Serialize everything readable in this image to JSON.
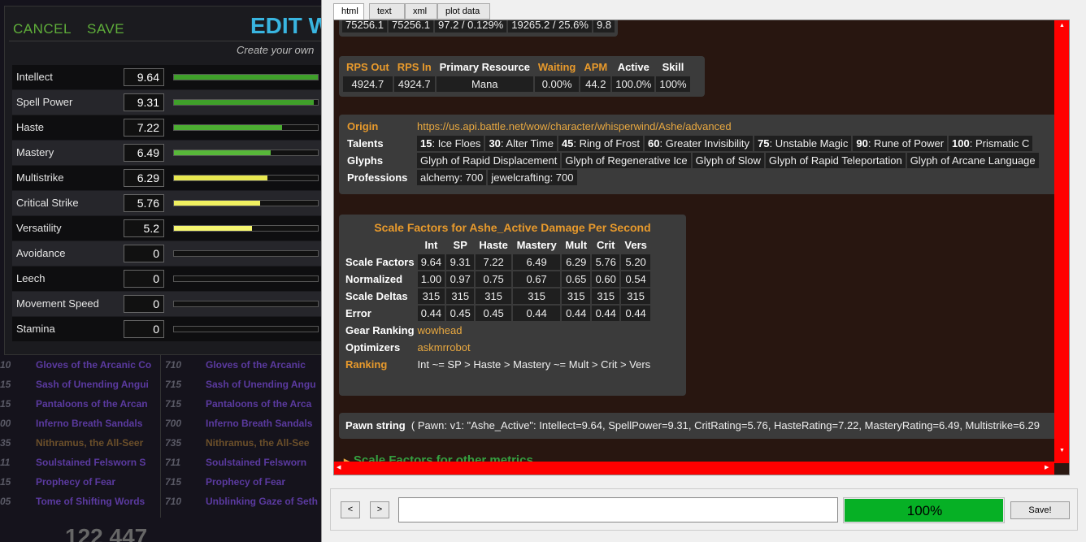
{
  "game": {
    "rows": [
      {
        "ilvl_left": "10",
        "name_left": "Gloves of the Arcanic Co",
        "ilvl_right": "710",
        "name_right": "Gloves of the Arcanic",
        "color": "purple"
      },
      {
        "ilvl_left": "15",
        "name_left": "Sash of Unending Angui",
        "ilvl_right": "715",
        "name_right": "Sash of Unending Angu",
        "color": "purple"
      },
      {
        "ilvl_left": "15",
        "name_left": "Pantaloons of the Arcan",
        "ilvl_right": "715",
        "name_right": "Pantaloons of the Arca",
        "color": "purple"
      },
      {
        "ilvl_left": "00",
        "name_left": "Inferno Breath Sandals",
        "ilvl_right": "700",
        "name_right": "Inferno Breath Sandals",
        "color": "purple"
      },
      {
        "ilvl_left": "35",
        "name_left": "Nithramus, the All-Seer",
        "ilvl_right": "735",
        "name_right": "Nithramus, the All-See",
        "color": "orange"
      },
      {
        "ilvl_left": "11",
        "name_left": "Soulstained Felsworn S",
        "ilvl_right": "711",
        "name_right": "Soulstained Felsworn",
        "color": "purple"
      },
      {
        "ilvl_left": "15",
        "name_left": "Prophecy of Fear",
        "ilvl_right": "715",
        "name_right": "Prophecy of Fear",
        "color": "purple"
      },
      {
        "ilvl_left": "05",
        "name_left": "Tome of Shifting Words",
        "ilvl_right": "710",
        "name_right": "Unblinking Gaze of Seth",
        "color": "purple"
      }
    ],
    "big_value": "122 447"
  },
  "edit_panel": {
    "cancel_label": "CANCEL",
    "save_label": "SAVE",
    "title": "EDIT W",
    "subtitle": "Create your own",
    "stats": [
      {
        "name": "Intellect",
        "value": "9.64",
        "level": 1.0,
        "color": "#3fa02a"
      },
      {
        "name": "Spell Power",
        "value": "9.31",
        "level": 0.97,
        "color": "#3fa02a"
      },
      {
        "name": "Haste",
        "value": "7.22",
        "level": 0.75,
        "color": "#4cae32"
      },
      {
        "name": "Mastery",
        "value": "6.49",
        "level": 0.67,
        "color": "#58b83a"
      },
      {
        "name": "Multistrike",
        "value": "6.29",
        "level": 0.65,
        "color": "#e8e850"
      },
      {
        "name": "Critical Strike",
        "value": "5.76",
        "level": 0.6,
        "color": "#f0f060"
      },
      {
        "name": "Versatility",
        "value": "5.2",
        "level": 0.54,
        "color": "#f5f570"
      },
      {
        "name": "Avoidance",
        "value": "0",
        "level": 0,
        "color": "#888"
      },
      {
        "name": "Leech",
        "value": "0",
        "level": 0,
        "color": "#888"
      },
      {
        "name": "Movement Speed",
        "value": "0",
        "level": 0,
        "color": "#888"
      },
      {
        "name": "Stamina",
        "value": "0",
        "level": 0,
        "color": "#888"
      }
    ]
  },
  "tabs": [
    "html",
    "text",
    "xml",
    "plot data"
  ],
  "report": {
    "top_row": [
      "75256.1",
      "75256.1",
      "97.2 / 0.129%",
      "19265.2 / 25.6%",
      "9.8"
    ],
    "rps": {
      "headers": [
        "RPS Out",
        "RPS In",
        "Primary Resource",
        "Waiting",
        "APM",
        "Active",
        "Skill"
      ],
      "values": [
        "4924.7",
        "4924.7",
        "Mana",
        "0.00%",
        "44.2",
        "100.0%",
        "100%"
      ]
    },
    "info": {
      "origin_label": "Origin",
      "origin_url": "https://us.api.battle.net/wow/character/whisperwind/Ashe/advanced",
      "talents_label": "Talents",
      "talents": [
        {
          "lvl": "15",
          "name": ": Ice Floes"
        },
        {
          "lvl": "30",
          "name": ": Alter Time"
        },
        {
          "lvl": "45",
          "name": ": Ring of Frost"
        },
        {
          "lvl": "60",
          "name": ": Greater Invisibility"
        },
        {
          "lvl": "75",
          "name": ": Unstable Magic"
        },
        {
          "lvl": "90",
          "name": ": Rune of Power"
        },
        {
          "lvl": "100",
          "name": ": Prismatic C"
        }
      ],
      "glyphs_label": "Glyphs",
      "glyphs": [
        "Glyph of Rapid Displacement",
        "Glyph of Regenerative Ice",
        "Glyph of Slow",
        "Glyph of Rapid Teleportation",
        "Glyph of Arcane Language"
      ],
      "professions_label": "Professions",
      "professions": [
        "alchemy: 700",
        "jewelcrafting: 700"
      ]
    },
    "scale": {
      "title": "Scale Factors for Ashe_Active Damage Per Second",
      "columns": [
        "Int",
        "SP",
        "Haste",
        "Mastery",
        "Mult",
        "Crit",
        "Vers"
      ],
      "rows": [
        {
          "label": "Scale Factors",
          "values": [
            "9.64",
            "9.31",
            "7.22",
            "6.49",
            "6.29",
            "5.76",
            "5.20"
          ]
        },
        {
          "label": "Normalized",
          "values": [
            "1.00",
            "0.97",
            "0.75",
            "0.67",
            "0.65",
            "0.60",
            "0.54"
          ]
        },
        {
          "label": "Scale Deltas",
          "values": [
            "315",
            "315",
            "315",
            "315",
            "315",
            "315",
            "315"
          ]
        },
        {
          "label": "Error",
          "values": [
            "0.44",
            "0.45",
            "0.45",
            "0.44",
            "0.44",
            "0.44",
            "0.44"
          ]
        }
      ],
      "gear_ranking_label": "Gear Ranking",
      "gear_ranking_value": "wowhead",
      "optimizers_label": "Optimizers",
      "optimizers_value": "askmrrobot",
      "ranking_label": "Ranking",
      "ranking_value": "Int ~= SP > Haste > Mastery ~= Mult > Crit > Vers"
    },
    "pawn": {
      "label": "Pawn string",
      "value": "( Pawn: v1: \"Ashe_Active\": Intellect=9.64, SpellPower=9.31, CritRating=5.76, HasteRating=7.22, MasteryRating=6.49, Multistrike=6.29"
    },
    "collapse_label": "Scale Factors for other metrics"
  },
  "bottom": {
    "back_label": "<",
    "forward_label": ">",
    "command_value": "",
    "progress_label": "100%",
    "progress_level": 1.0,
    "save_label": "Save!"
  },
  "colors": {
    "accent_green": "#5fae3a",
    "title_blue": "#39b5e0",
    "progress_green": "#06b025",
    "scroll_red": "#ff0000",
    "header_orange": "#e89a2c"
  }
}
